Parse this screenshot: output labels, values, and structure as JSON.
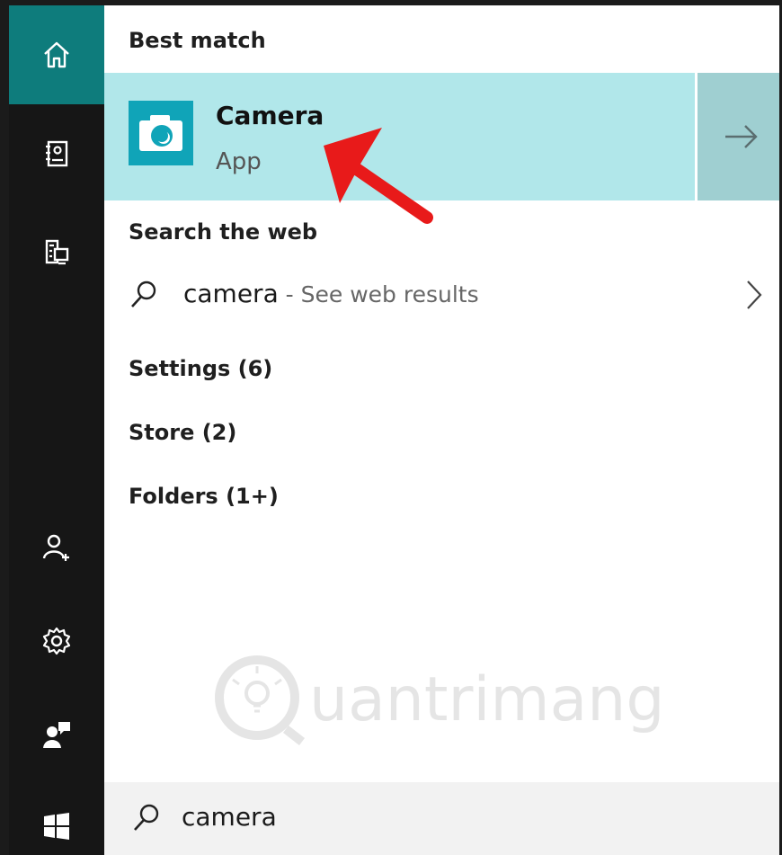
{
  "sidebar": {
    "items": [
      {
        "name": "home",
        "icon": "home-icon",
        "active": true
      },
      {
        "name": "notebook",
        "icon": "notebook-icon",
        "active": false
      },
      {
        "name": "devices",
        "icon": "devices-icon",
        "active": false
      },
      {
        "name": "account",
        "icon": "add-user-icon",
        "active": false
      },
      {
        "name": "settings",
        "icon": "gear-icon",
        "active": false
      },
      {
        "name": "feedback",
        "icon": "feedback-icon",
        "active": false
      },
      {
        "name": "start",
        "icon": "windows-icon",
        "active": false
      }
    ]
  },
  "results": {
    "best_match_heading": "Best match",
    "best_match": {
      "title": "Camera",
      "subtitle": "App",
      "icon": "camera-icon"
    },
    "web_heading": "Search the web",
    "web_result": {
      "query": "camera",
      "separator": " - ",
      "hint": "See web results"
    },
    "categories": [
      {
        "label": "Settings (6)"
      },
      {
        "label": "Store (2)"
      },
      {
        "label": "Folders (1+)"
      }
    ]
  },
  "search": {
    "value": "camera",
    "icon": "search-icon"
  },
  "watermark": {
    "text": "uantrimang"
  },
  "colors": {
    "sidebar_bg": "#161616",
    "active_accent": "#0e7c7c",
    "best_match_bg": "#b1e7ea",
    "app_tile": "#10a4b8",
    "annotation_arrow": "#e81a1a"
  }
}
